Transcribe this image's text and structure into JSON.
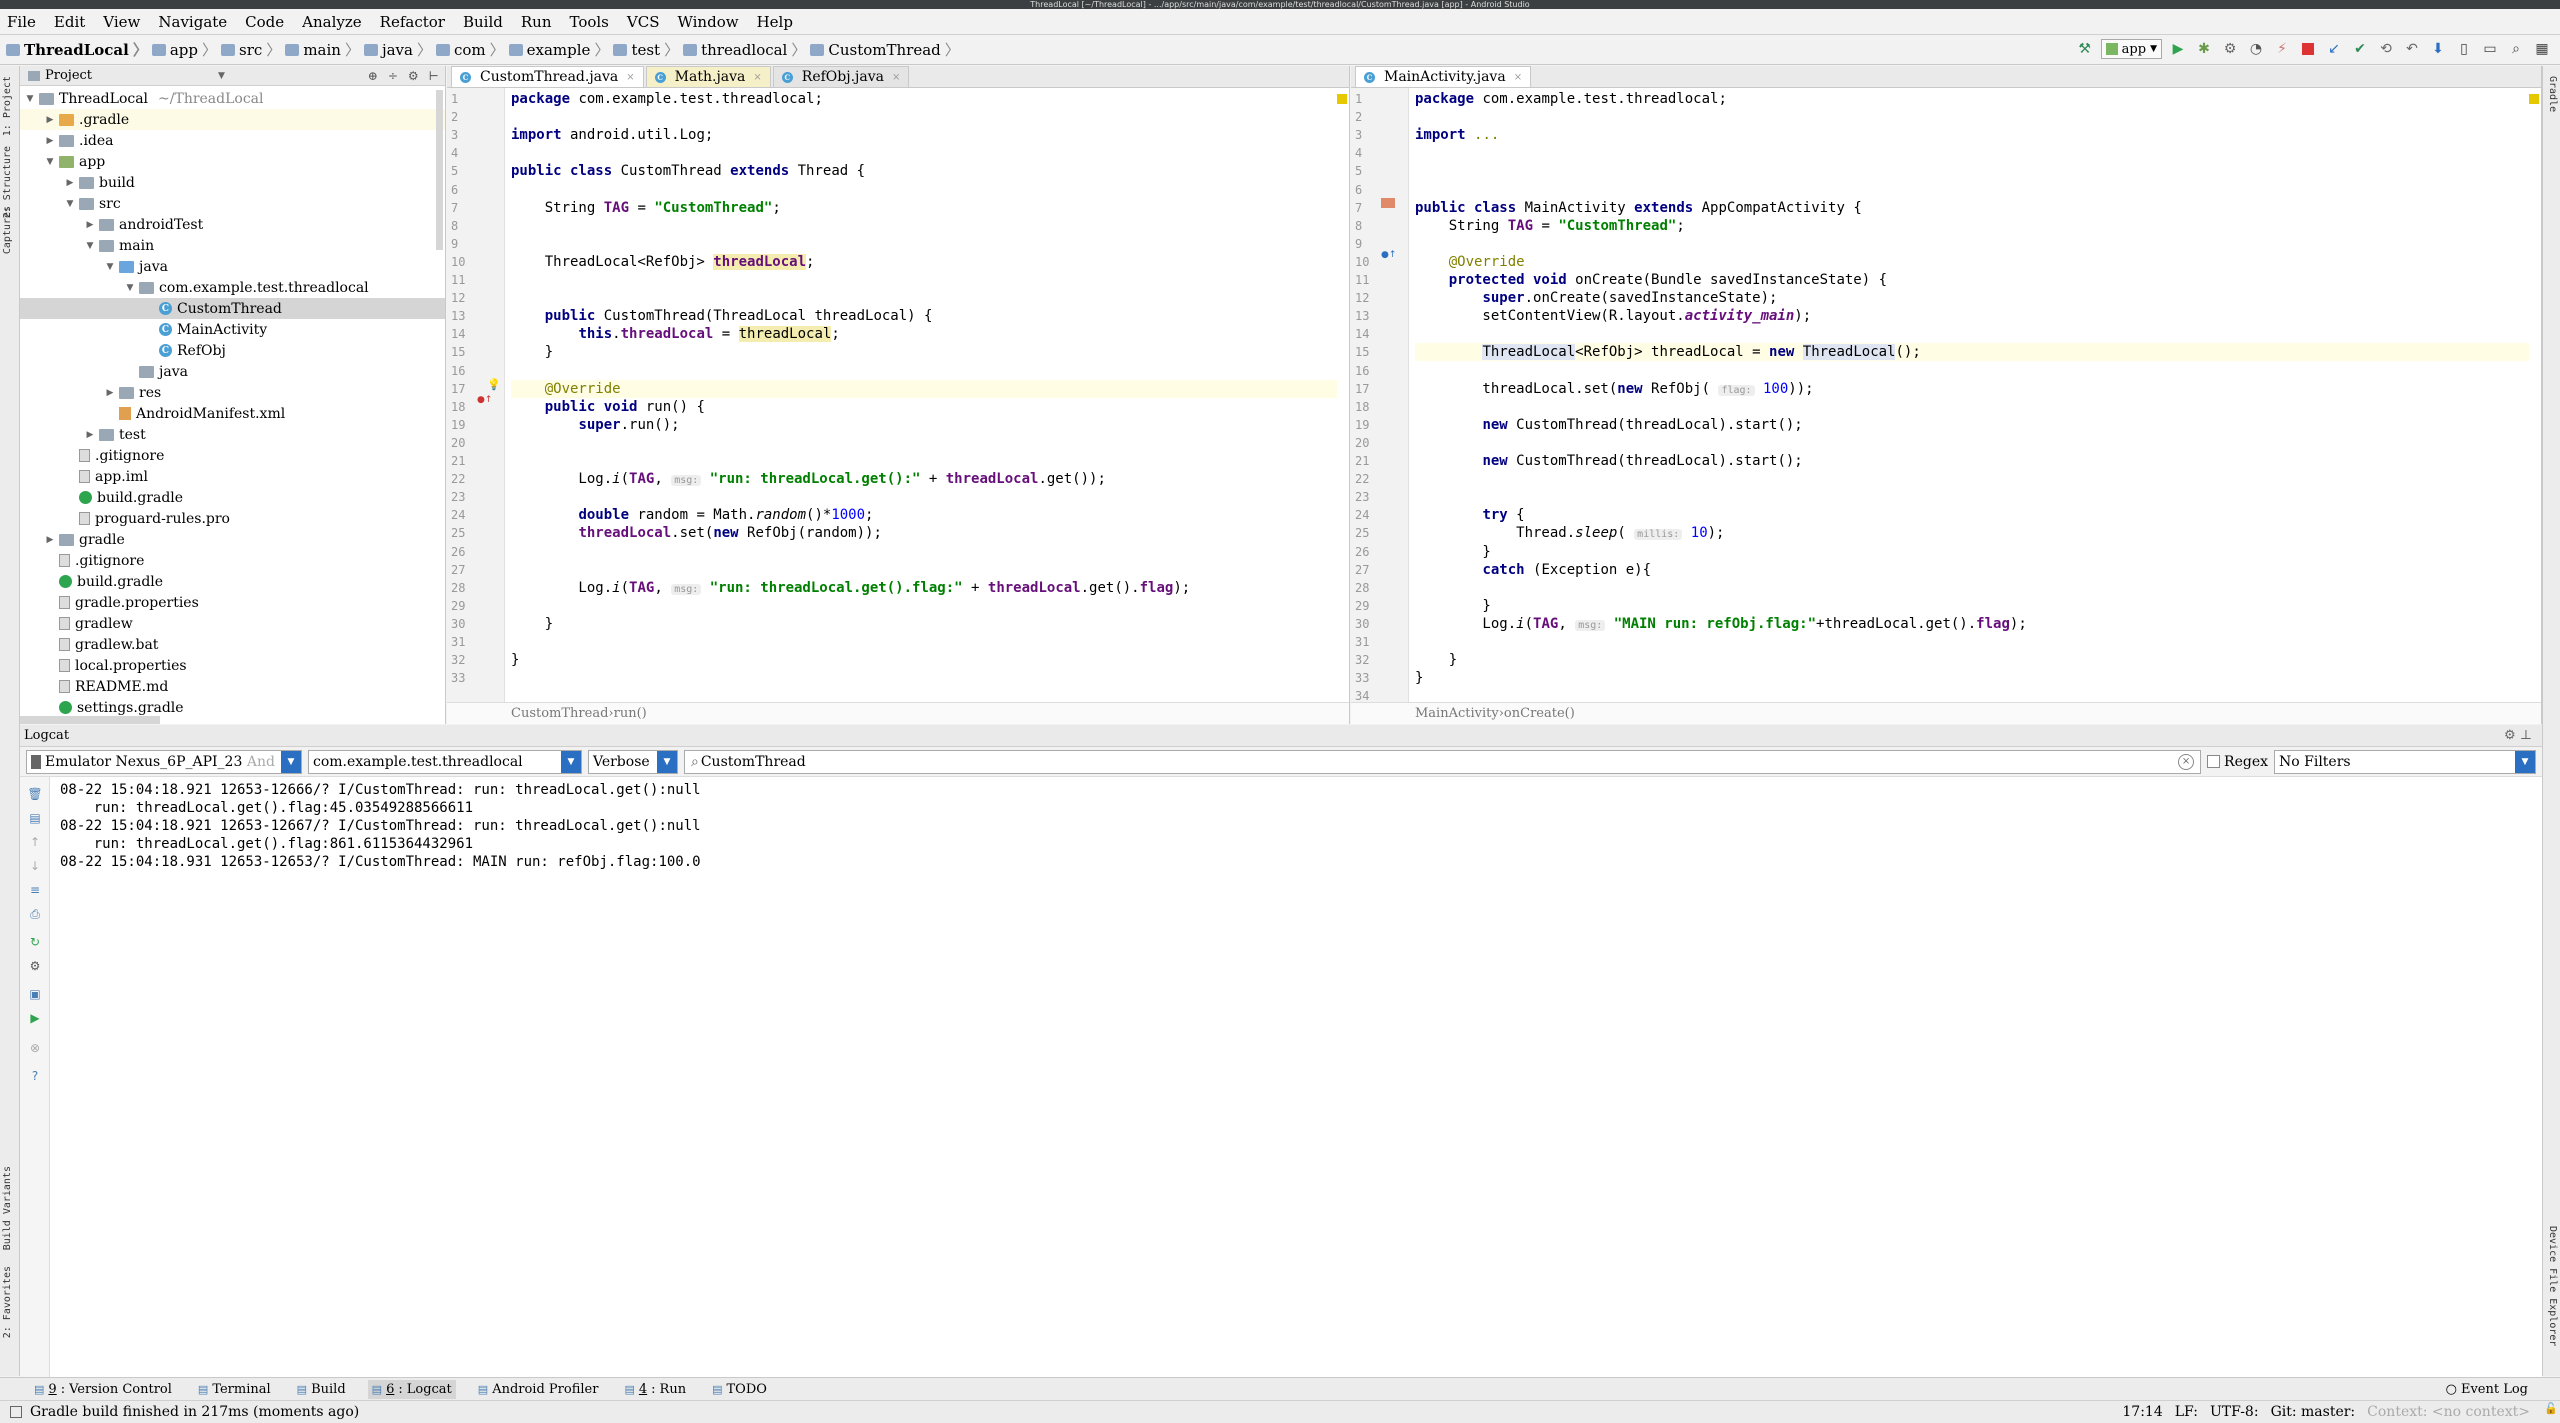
{
  "window": {
    "title": "ThreadLocal [~/ThreadLocal] - .../app/src/main/java/com/example/test/threadlocal/CustomThread.java [app] - Android Studio"
  },
  "menu": [
    "File",
    "Edit",
    "View",
    "Navigate",
    "Code",
    "Analyze",
    "Refactor",
    "Build",
    "Run",
    "Tools",
    "VCS",
    "Window",
    "Help"
  ],
  "breadcrumbs": [
    "ThreadLocal",
    "app",
    "src",
    "main",
    "java",
    "com",
    "example",
    "test",
    "threadlocal",
    "CustomThread"
  ],
  "run_config": "app",
  "project_panel": {
    "title": "Project",
    "tree": [
      {
        "label": "ThreadLocal",
        "sub": "~/ThreadLocal",
        "depth": 0,
        "arrow": "▼",
        "icon": "folder"
      },
      {
        "label": ".gradle",
        "depth": 1,
        "arrow": "▶",
        "icon": "folder org"
      },
      {
        "label": ".idea",
        "depth": 1,
        "arrow": "▶",
        "icon": "folder"
      },
      {
        "label": "app",
        "depth": 1,
        "arrow": "▼",
        "icon": "folder grn"
      },
      {
        "label": "build",
        "depth": 2,
        "arrow": "▶",
        "icon": "folder"
      },
      {
        "label": "src",
        "depth": 2,
        "arrow": "▼",
        "icon": "folder"
      },
      {
        "label": "androidTest",
        "depth": 3,
        "arrow": "▶",
        "icon": "folder"
      },
      {
        "label": "main",
        "depth": 3,
        "arrow": "▼",
        "icon": "folder"
      },
      {
        "label": "java",
        "depth": 4,
        "arrow": "▼",
        "icon": "folder blue"
      },
      {
        "label": "com.example.test.threadlocal",
        "depth": 5,
        "arrow": "▼",
        "icon": "folder"
      },
      {
        "label": "CustomThread",
        "depth": 6,
        "arrow": "",
        "icon": "cls",
        "selected": true
      },
      {
        "label": "MainActivity",
        "depth": 6,
        "arrow": "",
        "icon": "cls"
      },
      {
        "label": "RefObj",
        "depth": 6,
        "arrow": "",
        "icon": "cls"
      },
      {
        "label": "java",
        "depth": 5,
        "arrow": "",
        "icon": "folder"
      },
      {
        "label": "res",
        "depth": 4,
        "arrow": "▶",
        "icon": "folder"
      },
      {
        "label": "AndroidManifest.xml",
        "depth": 4,
        "arrow": "",
        "icon": "xml"
      },
      {
        "label": "test",
        "depth": 3,
        "arrow": "▶",
        "icon": "folder"
      },
      {
        "label": ".gitignore",
        "depth": 2,
        "arrow": "",
        "icon": "file"
      },
      {
        "label": "app.iml",
        "depth": 2,
        "arrow": "",
        "icon": "file"
      },
      {
        "label": "build.gradle",
        "depth": 2,
        "arrow": "",
        "icon": "gfile"
      },
      {
        "label": "proguard-rules.pro",
        "depth": 2,
        "arrow": "",
        "icon": "file"
      },
      {
        "label": "gradle",
        "depth": 1,
        "arrow": "▶",
        "icon": "folder"
      },
      {
        "label": ".gitignore",
        "depth": 1,
        "arrow": "",
        "icon": "file"
      },
      {
        "label": "build.gradle",
        "depth": 1,
        "arrow": "",
        "icon": "gfile"
      },
      {
        "label": "gradle.properties",
        "depth": 1,
        "arrow": "",
        "icon": "file"
      },
      {
        "label": "gradlew",
        "depth": 1,
        "arrow": "",
        "icon": "file"
      },
      {
        "label": "gradlew.bat",
        "depth": 1,
        "arrow": "",
        "icon": "file"
      },
      {
        "label": "local.properties",
        "depth": 1,
        "arrow": "",
        "icon": "file"
      },
      {
        "label": "README.md",
        "depth": 1,
        "arrow": "",
        "icon": "file"
      },
      {
        "label": "settings.gradle",
        "depth": 1,
        "arrow": "",
        "icon": "gfile"
      }
    ]
  },
  "editor_left": {
    "tabs": [
      {
        "label": "CustomThread.java",
        "active": true
      },
      {
        "label": "Math.java",
        "yellow": true
      },
      {
        "label": "RefObj.java"
      }
    ],
    "line_count": 33,
    "breadcrumb": [
      "CustomThread",
      "run()"
    ],
    "lines": [
      {
        "n": 1,
        "html": "<span class=\"kw\">package</span> com.example.test.threadlocal;"
      },
      {
        "n": 3,
        "html": "<span class=\"kw\">import</span> android.util.Log;"
      },
      {
        "n": 5,
        "html": "<span class=\"kw\">public class</span> CustomThread <span class=\"kw\">extends</span> Thread {"
      },
      {
        "n": 7,
        "html": "    String <span class=\"fld\">TAG</span> = <span class=\"str\">\"CustomThread\"</span>;"
      },
      {
        "n": 10,
        "html": "    ThreadLocal&lt;RefObj&gt; <span class=\"fld hlv\">threadLocal</span>;"
      },
      {
        "n": 13,
        "html": "    <span class=\"kw\">public</span> CustomThread(ThreadLocal threadLocal) {"
      },
      {
        "n": 14,
        "html": "        <span class=\"kw\">this</span>.<span class=\"fld\">threadLocal</span> = <span class=\"hlv\">threadLocal</span>;"
      },
      {
        "n": 15,
        "html": "    }"
      },
      {
        "n": 17,
        "html": "    <span class=\"ann\">@Override</span>",
        "cur": true
      },
      {
        "n": 18,
        "html": "    <span class=\"kw\">public void</span> run() {"
      },
      {
        "n": 19,
        "html": "        <span class=\"kw\">super</span>.run();"
      },
      {
        "n": 22,
        "html": "        Log.<span class=\"it\">i</span>(<span class=\"fld\">TAG</span>, <span class=\"hint\">msg:</span> <span class=\"str\">\"run: threadLocal.get():\"</span> + <span class=\"fld\">threadLocal</span>.get());"
      },
      {
        "n": 24,
        "html": "        <span class=\"kw\">double</span> random = Math.<span class=\"it\">random</span>()*<span class=\"num\">1000</span>;"
      },
      {
        "n": 25,
        "html": "        <span class=\"fld\">threadLocal</span>.set(<span class=\"kw\">new</span> RefObj(random));"
      },
      {
        "n": 28,
        "html": "        Log.<span class=\"it\">i</span>(<span class=\"fld\">TAG</span>, <span class=\"hint\">msg:</span> <span class=\"str\">\"run: threadLocal.get().flag:\"</span> + <span class=\"fld\">threadLocal</span>.get().<span class=\"fld\">flag</span>);"
      },
      {
        "n": 30,
        "html": "    }"
      },
      {
        "n": 32,
        "html": "}"
      }
    ]
  },
  "editor_right": {
    "tabs": [
      {
        "label": "MainActivity.java",
        "active": true
      }
    ],
    "line_count": 34,
    "breadcrumb": [
      "MainActivity",
      "onCreate()"
    ],
    "lines": [
      {
        "n": 1,
        "html": "<span class=\"kw\">package</span> com.example.test.threadlocal;"
      },
      {
        "n": 3,
        "html": "<span class=\"kw\">import</span> <span class=\"ann\">...</span>"
      },
      {
        "n": 7,
        "html": "<span class=\"kw\">public class</span> MainActivity <span class=\"kw\">extends</span> AppCompatActivity {"
      },
      {
        "n": 8,
        "html": "    String <span class=\"fld\">TAG</span> = <span class=\"str\">\"CustomThread\"</span>;"
      },
      {
        "n": 10,
        "html": "    <span class=\"ann\">@Override</span>"
      },
      {
        "n": 11,
        "html": "    <span class=\"kw\">protected void</span> onCreate(Bundle savedInstanceState) {"
      },
      {
        "n": 12,
        "html": "        <span class=\"kw\">super</span>.onCreate(savedInstanceState);"
      },
      {
        "n": 13,
        "html": "        setContentView(R.layout.<span class=\"fld it\">activity_main</span>);"
      },
      {
        "n": 15,
        "html": "        <span class=\"hlv2\">ThreadLocal</span>&lt;RefObj&gt; threadLocal = <span class=\"kw\">new</span> <span class=\"hlv2\">ThreadLocal</span>();",
        "cur": true
      },
      {
        "n": 17,
        "html": "        threadLocal.set(<span class=\"kw\">new</span> RefObj( <span class=\"hint\">flag:</span> <span class=\"num\">100</span>));"
      },
      {
        "n": 19,
        "html": "        <span class=\"kw\">new</span> CustomThread(threadLocal).start();"
      },
      {
        "n": 21,
        "html": "        <span class=\"kw\">new</span> CustomThread(threadLocal).start();"
      },
      {
        "n": 24,
        "html": "        <span class=\"kw\">try</span> {"
      },
      {
        "n": 25,
        "html": "            Thread.<span class=\"it\">sleep</span>( <span class=\"hint\">millis:</span> <span class=\"num\">10</span>);"
      },
      {
        "n": 26,
        "html": "        }"
      },
      {
        "n": 27,
        "html": "        <span class=\"kw\">catch</span> (Exception e){"
      },
      {
        "n": 29,
        "html": "        }"
      },
      {
        "n": 30,
        "html": "        Log.<span class=\"it\">i</span>(<span class=\"fld\">TAG</span>, <span class=\"hint\">msg:</span> <span class=\"str\">\"MAIN run: refObj.flag:\"</span>+threadLocal.get().<span class=\"fld\">flag</span>);"
      },
      {
        "n": 32,
        "html": "    }"
      },
      {
        "n": 33,
        "html": "}"
      }
    ]
  },
  "logcat": {
    "title": "Logcat",
    "device": "Emulator Nexus_6P_API_23",
    "device_suffix": "And",
    "process": "com.example.test.threadlocal",
    "level": "Verbose",
    "search": "CustomThread",
    "regex_label": "Regex",
    "filter": "No Filters",
    "lines": [
      "08-22 15:04:18.921 12653-12666/? I/CustomThread: run: threadLocal.get():null",
      "    run: threadLocal.get().flag:45.03549288566611",
      "08-22 15:04:18.921 12653-12667/? I/CustomThread: run: threadLocal.get():null",
      "    run: threadLocal.get().flag:861.6115364432961",
      "08-22 15:04:18.931 12653-12653/? I/CustomThread: MAIN run: refObj.flag:100.0"
    ]
  },
  "bottom_tabs": [
    {
      "num": "9",
      "label": "Version Control"
    },
    {
      "num": "",
      "label": "Terminal"
    },
    {
      "num": "",
      "label": "Build"
    },
    {
      "num": "6",
      "label": "Logcat",
      "active": true
    },
    {
      "num": "",
      "label": "Android Profiler"
    },
    {
      "num": "4",
      "label": "Run"
    },
    {
      "num": "",
      "label": "TODO"
    }
  ],
  "event_log": "Event Log",
  "status": {
    "message": "Gradle build finished in 217ms (moments ago)",
    "position": "17:14",
    "line_sep": "LF:",
    "encoding": "UTF-8:",
    "git": "Git: master:",
    "context": "Context: <no context>"
  },
  "left_vertical_tabs": [
    "1: Project",
    "2: Structure",
    "Captures",
    "Build Variants",
    "2: Favorites"
  ],
  "right_vertical_tabs": [
    "Gradle",
    "Device File Explorer"
  ]
}
